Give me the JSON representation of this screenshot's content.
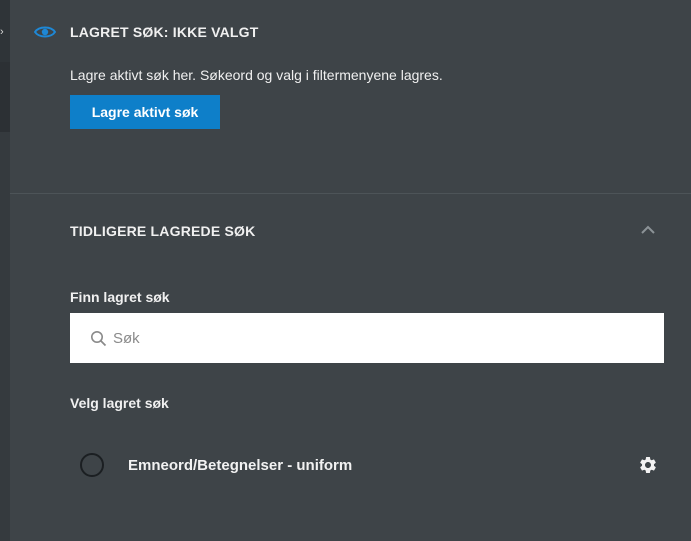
{
  "active_search": {
    "title": "LAGRET SØK: IKKE VALGT",
    "description": "Lagre aktivt søk her. Søkeord og valg i filtermenyene lagres.",
    "save_button_label": "Lagre aktivt søk"
  },
  "previous_searches": {
    "title": "TIDLIGERE LAGREDE SØK",
    "find_label": "Finn lagret søk",
    "search_placeholder": "Søk",
    "choose_label": "Velg lagret søk",
    "items": [
      {
        "label": "Emneord/Betegnelser - uniform",
        "selected": false
      }
    ]
  },
  "icons": {
    "header": "eye-icon",
    "collapse": "chevron-up-icon",
    "search": "search-icon",
    "settings": "gear-icon"
  },
  "colors": {
    "background": "#3e4448",
    "accent": "#0e7fc9",
    "eye_icon": "#1e88d6"
  }
}
